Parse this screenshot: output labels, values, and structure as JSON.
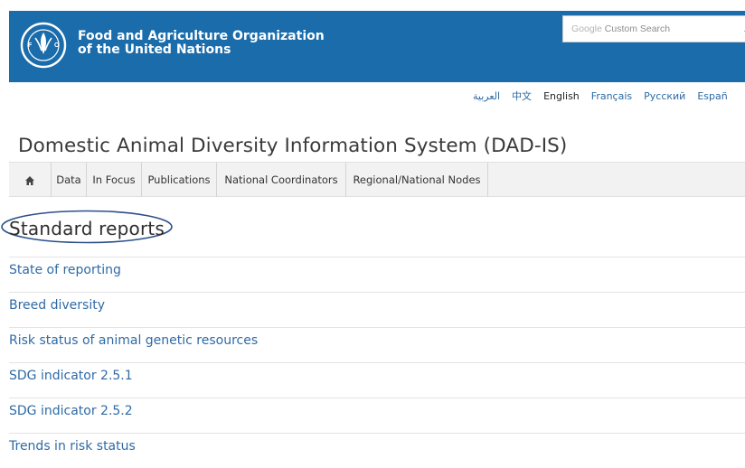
{
  "header": {
    "org_name_line1": "Food and Agriculture Organization",
    "org_name_line2": "of the United Nations",
    "logo_text": "FAO",
    "search": {
      "brand_google": "Google",
      "brand_custom": "Custom Search"
    }
  },
  "languages": [
    {
      "label": "العربية",
      "active": false
    },
    {
      "label": "中文",
      "active": false
    },
    {
      "label": "English",
      "active": true
    },
    {
      "label": "Français",
      "active": false
    },
    {
      "label": "Русский",
      "active": false
    },
    {
      "label": "Españ",
      "active": false
    }
  ],
  "site_title": "Domestic Animal Diversity Information System (DAD-IS)",
  "nav": {
    "home_icon": "home-icon",
    "items": [
      "Data",
      "In Focus",
      "Publications",
      "National Coordinators",
      "Regional/National Nodes"
    ]
  },
  "section_title": "Standard reports",
  "reports": [
    "State of reporting",
    "Breed diversity",
    "Risk status of animal genetic resources",
    "SDG indicator 2.5.1",
    "SDG indicator 2.5.2",
    "Trends in risk status"
  ],
  "colors": {
    "header_bg": "#1a6cab",
    "link": "#2f6aa6",
    "annotation": "#2a4f8a"
  }
}
